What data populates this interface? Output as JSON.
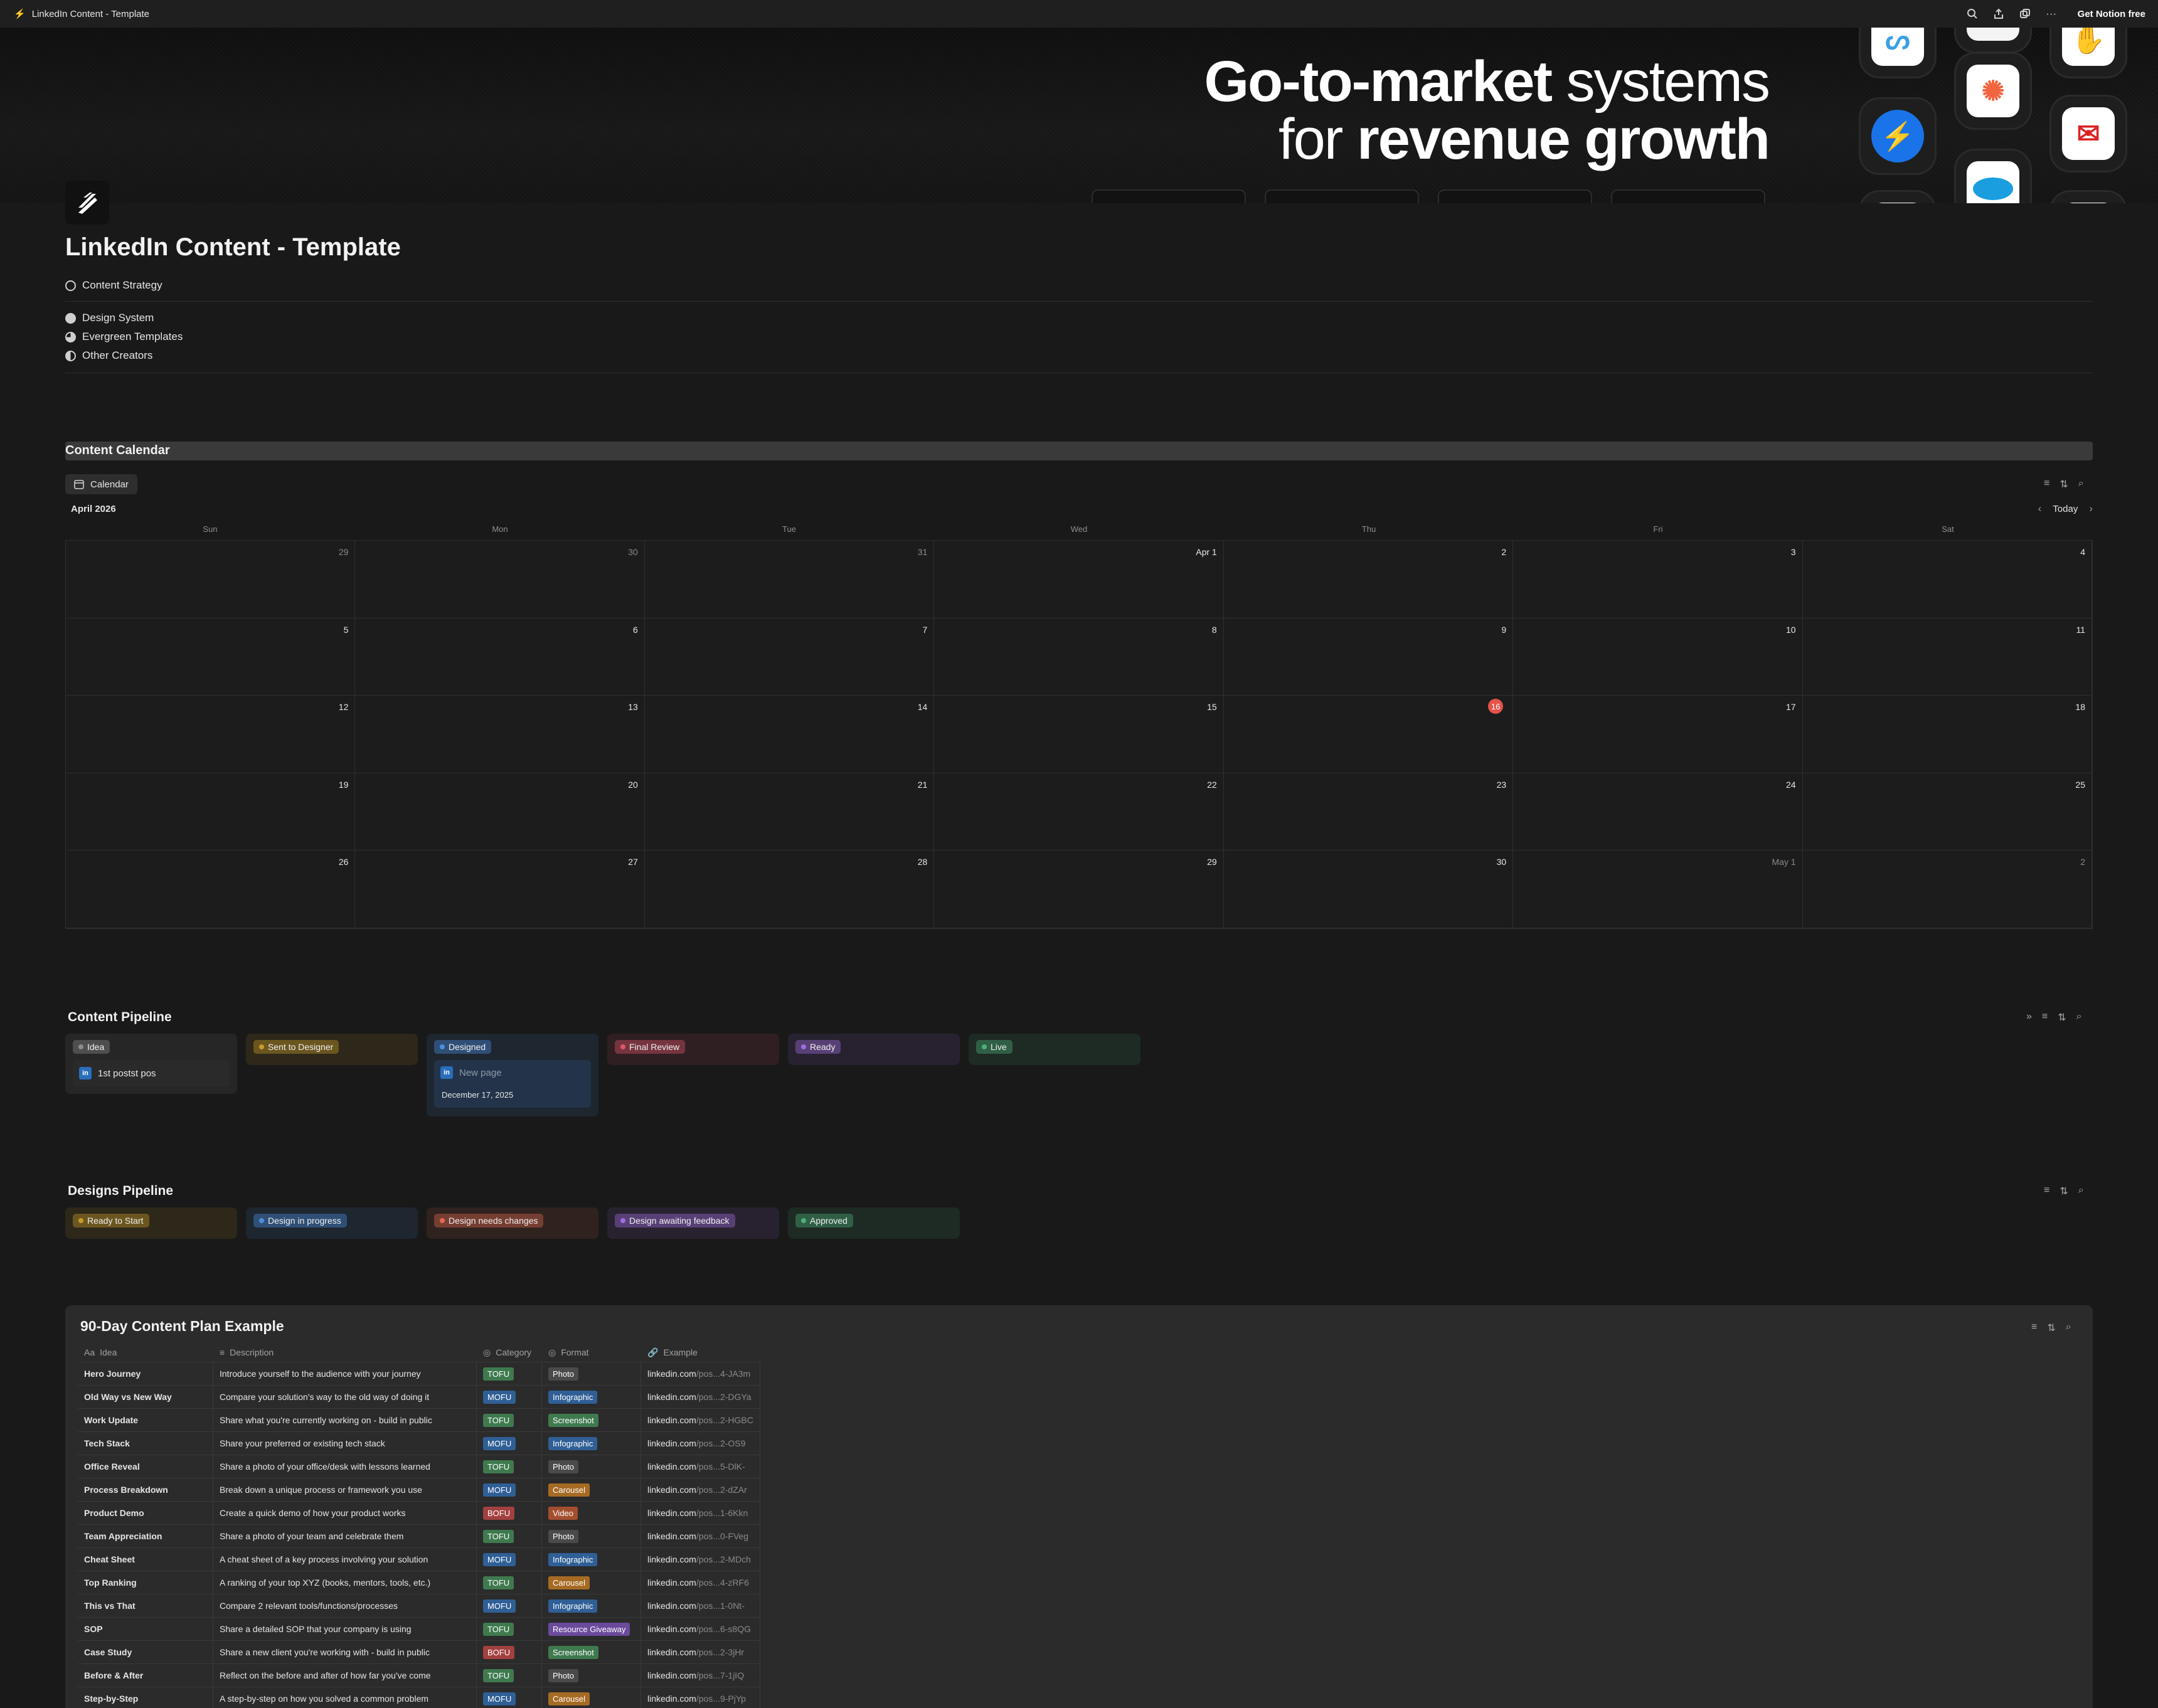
{
  "window": {
    "title": "LinkedIn Content - Template",
    "cta": "Get Notion free"
  },
  "cover": {
    "line1_bold": "Go-to-market",
    "line1_rest": " systems",
    "line2_pre": "for ",
    "line2_bold": "revenue growth"
  },
  "page": {
    "title": "LinkedIn Content - Template"
  },
  "links": [
    "Content Strategy",
    "Design System",
    "Evergreen Templates",
    "Other Creators"
  ],
  "calendar": {
    "section_title": "Content Calendar",
    "view_label": "Calendar",
    "month": "April 2026",
    "today_label": "Today",
    "days": [
      "Sun",
      "Mon",
      "Tue",
      "Wed",
      "Thu",
      "Fri",
      "Sat"
    ],
    "cells": [
      "29",
      "30",
      "31",
      "Apr 1",
      "2",
      "3",
      "4",
      "5",
      "6",
      "7",
      "8",
      "9",
      "10",
      "11",
      "12",
      "13",
      "14",
      "15",
      "16",
      "17",
      "18",
      "19",
      "20",
      "21",
      "22",
      "23",
      "24",
      "25",
      "26",
      "27",
      "28",
      "29",
      "30",
      "May 1",
      "2"
    ],
    "today": "16"
  },
  "content_pipeline": {
    "title": "Content Pipeline",
    "columns": [
      {
        "label": "Idea",
        "color": "#8c8c8c"
      },
      {
        "label": "Sent to Designer",
        "color": "#c89b2b"
      },
      {
        "label": "Designed",
        "color": "#4a8fe0"
      },
      {
        "label": "Final Review",
        "color": "#e0566b"
      },
      {
        "label": "Ready",
        "color": "#a06ee0"
      },
      {
        "label": "Live",
        "color": "#4caf7a"
      }
    ],
    "card_idea": "1st postst pos",
    "card_designed_title": "New page",
    "card_designed_date": "December 17, 2025"
  },
  "designs_pipeline": {
    "title": "Designs Pipeline",
    "columns": [
      {
        "label": "Ready to Start",
        "color": "#c89b2b"
      },
      {
        "label": "Design in progress",
        "color": "#4a8fe0"
      },
      {
        "label": "Design needs changes",
        "color": "#e06a4f"
      },
      {
        "label": "Design awaiting feedback",
        "color": "#a06ee0"
      },
      {
        "label": "Approved",
        "color": "#4caf7a"
      }
    ]
  },
  "plan": {
    "title": "90-Day Content Plan Example",
    "headers": [
      "Idea",
      "Description",
      "Category",
      "Format",
      "Example"
    ],
    "rows": [
      {
        "idea": "Hero Journey",
        "desc": "Introduce yourself to the audience with your journey",
        "cat": "TOFU",
        "fmt": "Photo",
        "ex": "linkedin.com",
        "exs": "/pos...4-JA3m"
      },
      {
        "idea": "Old Way vs New Way",
        "desc": "Compare your solution's way to the old way of doing it",
        "cat": "MOFU",
        "fmt": "Infographic",
        "ex": "linkedin.com",
        "exs": "/pos...2-DGYa"
      },
      {
        "idea": "Work Update",
        "desc": "Share what you're currently working on - build in public",
        "cat": "TOFU",
        "fmt": "Screenshot",
        "ex": "linkedin.com",
        "exs": "/pos...2-HGBC"
      },
      {
        "idea": "Tech Stack",
        "desc": "Share your preferred or existing tech stack",
        "cat": "MOFU",
        "fmt": "Infographic",
        "ex": "linkedin.com",
        "exs": "/pos...2-OS9"
      },
      {
        "idea": "Office Reveal",
        "desc": "Share a photo of your office/desk with lessons learned",
        "cat": "TOFU",
        "fmt": "Photo",
        "ex": "linkedin.com",
        "exs": "/pos...5-DlK-"
      },
      {
        "idea": "Process Breakdown",
        "desc": "Break down a unique process or framework you use",
        "cat": "MOFU",
        "fmt": "Carousel",
        "ex": "linkedin.com",
        "exs": "/pos...2-dZAr"
      },
      {
        "idea": "Product Demo",
        "desc": "Create a quick demo of how your product works",
        "cat": "BOFU",
        "fmt": "Video",
        "ex": "linkedin.com",
        "exs": "/pos...1-6Kkn"
      },
      {
        "idea": "Team Appreciation",
        "desc": "Share a photo of your team and celebrate them",
        "cat": "TOFU",
        "fmt": "Photo",
        "ex": "linkedin.com",
        "exs": "/pos...0-FVeg"
      },
      {
        "idea": "Cheat Sheet",
        "desc": "A cheat sheet of a key process involving your solution",
        "cat": "MOFU",
        "fmt": "Infographic",
        "ex": "linkedin.com",
        "exs": "/pos...2-MDch"
      },
      {
        "idea": "Top Ranking",
        "desc": "A ranking of your top XYZ (books, mentors, tools, etc.)",
        "cat": "TOFU",
        "fmt": "Carousel",
        "ex": "linkedin.com",
        "exs": "/pos...4-zRF6"
      },
      {
        "idea": "This vs That",
        "desc": "Compare 2 relevant tools/functions/processes",
        "cat": "MOFU",
        "fmt": "Infographic",
        "ex": "linkedin.com",
        "exs": "/pos...1-0Nt-"
      },
      {
        "idea": "SOP",
        "desc": "Share a detailed SOP that your company is using",
        "cat": "TOFU",
        "fmt": "Resource Giveaway",
        "ex": "linkedin.com",
        "exs": "/pos...6-s8QG"
      },
      {
        "idea": "Case Study",
        "desc": "Share a new client you're working with - build in public",
        "cat": "BOFU",
        "fmt": "Screenshot",
        "ex": "linkedin.com",
        "exs": "/pos...2-3jHr"
      },
      {
        "idea": "Before & After",
        "desc": "Reflect on the before and after of how far you've come",
        "cat": "TOFU",
        "fmt": "Photo",
        "ex": "linkedin.com",
        "exs": "/pos...7-1jIQ"
      },
      {
        "idea": "Step-by-Step",
        "desc": "A step-by-step on how you solved a common problem",
        "cat": "MOFU",
        "fmt": "Carousel",
        "ex": "linkedin.com",
        "exs": "/pos...9-PjYp"
      }
    ]
  },
  "colors": {
    "TOFU": "#3f7a4f",
    "MOFU": "#2f5f96",
    "BOFU": "#a34040",
    "Photo": "#4a4a4a",
    "Infographic": "#2f5f96",
    "Screenshot": "#3f7a4f",
    "Carousel": "#a66b23",
    "Video": "#a34f2f",
    "Resource Giveaway": "#6b4a9c"
  }
}
